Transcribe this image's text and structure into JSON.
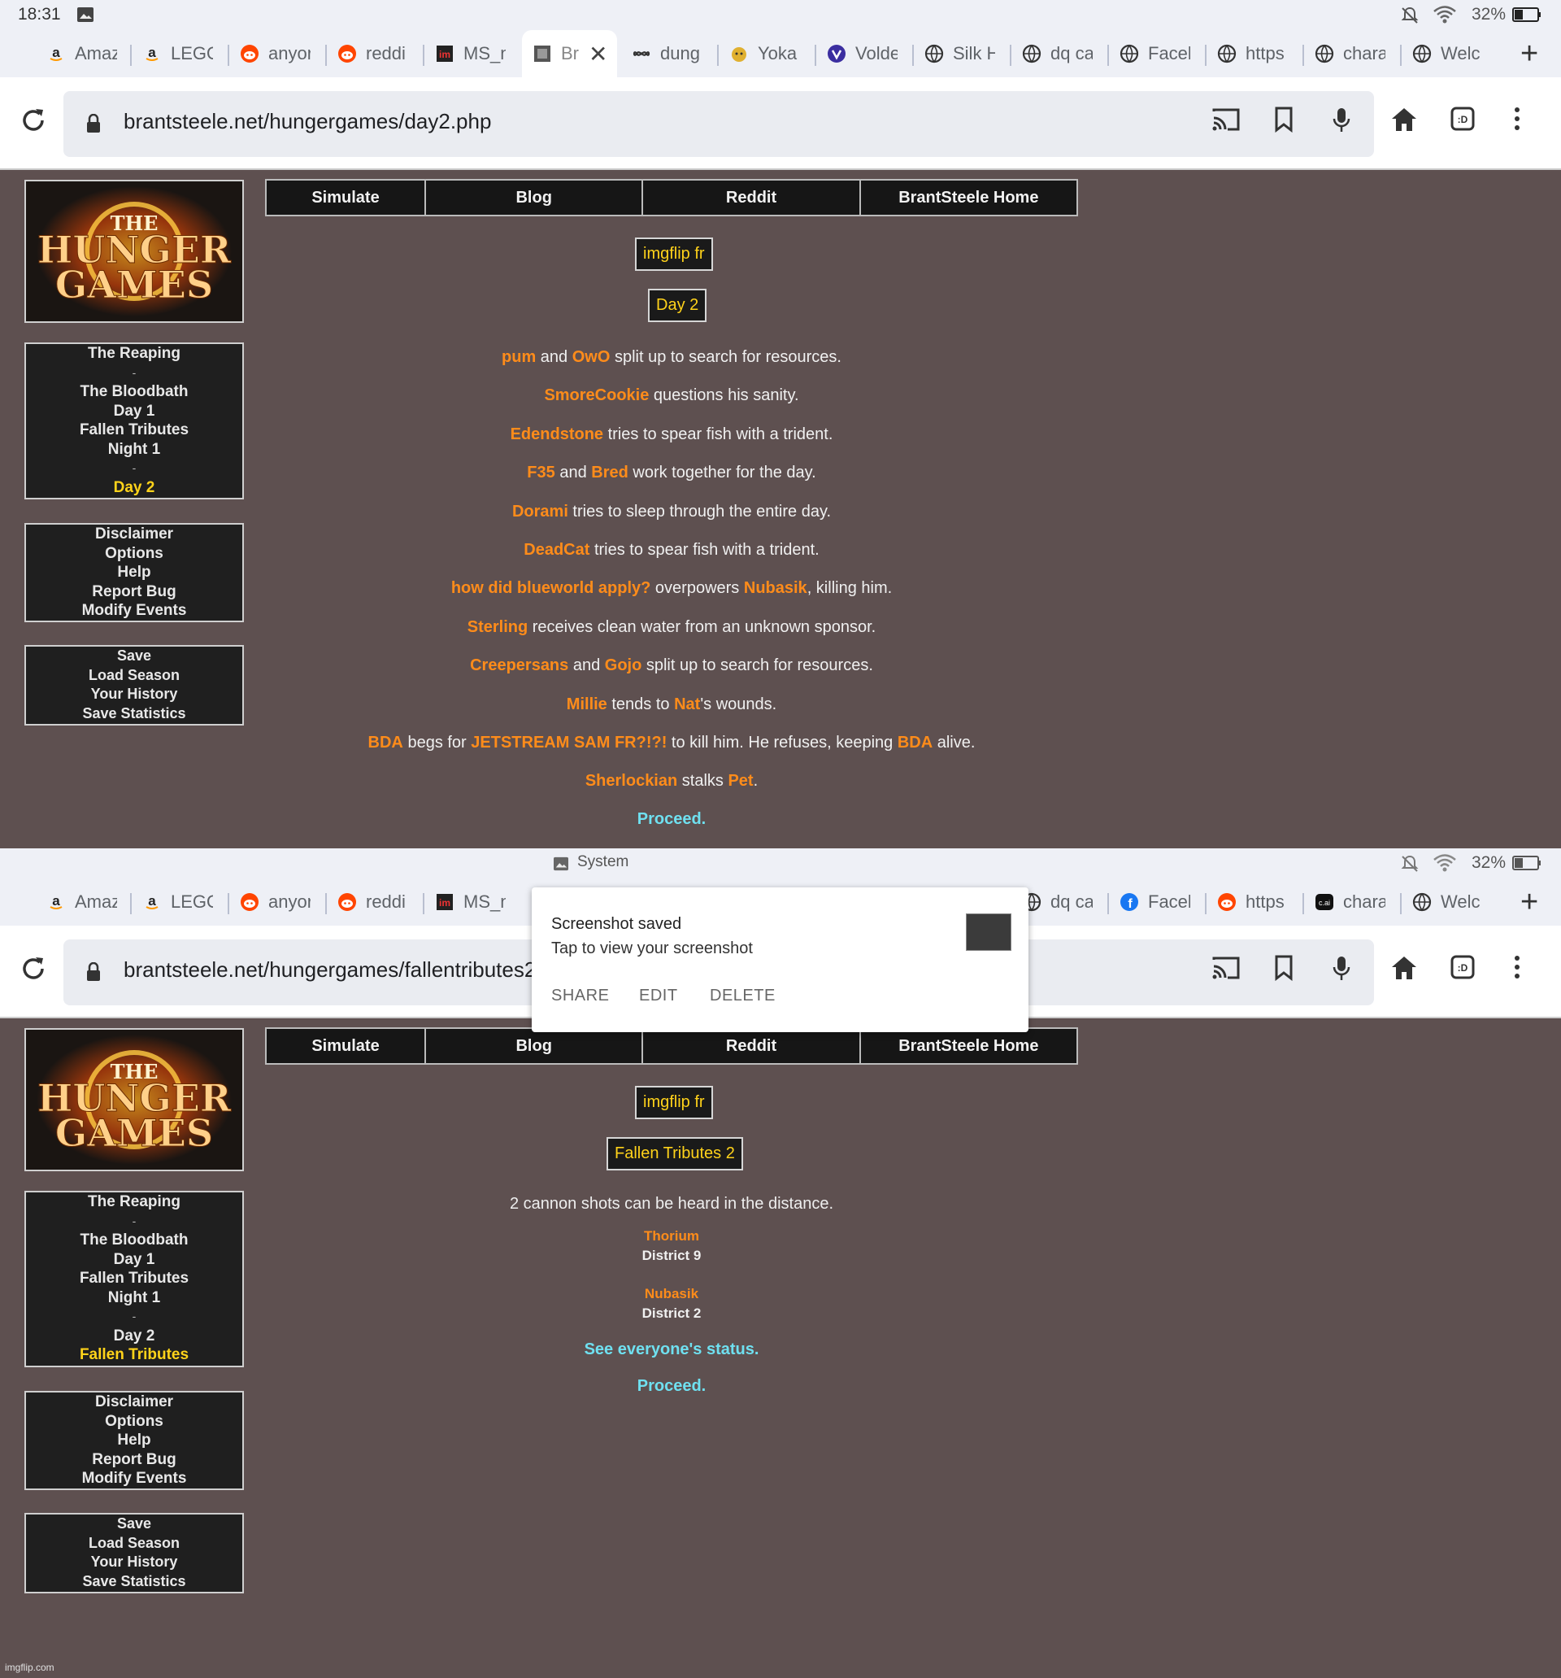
{
  "screens": [
    {
      "status": {
        "time": "18:31",
        "battery": "32%"
      },
      "tabs": [
        {
          "label": "Amaz",
          "icon": "amazon-icon"
        },
        {
          "label": "LEGO",
          "icon": "amazon-icon"
        },
        {
          "label": "anyor",
          "icon": "reddit-icon"
        },
        {
          "label": "reddi",
          "icon": "reddit-icon"
        },
        {
          "label": "MS_n",
          "icon": "imgflip-icon"
        },
        {
          "label": "Br",
          "icon": "site-icon",
          "active": true
        },
        {
          "label": "dung",
          "icon": "infinity-icon"
        },
        {
          "label": "Yoka",
          "icon": "yokai-icon"
        },
        {
          "label": "Volde",
          "icon": "shield-icon"
        },
        {
          "label": "Silk H",
          "icon": "globe-icon"
        },
        {
          "label": "dq ca",
          "icon": "globe-icon"
        },
        {
          "label": "Faceb",
          "icon": "globe-icon"
        },
        {
          "label": "https",
          "icon": "globe-icon"
        },
        {
          "label": "chara",
          "icon": "globe-icon"
        },
        {
          "label": "Welc",
          "icon": "globe-icon"
        }
      ],
      "url": "brantsteele.net/hungergames/day2.php",
      "nav": [
        "Simulate",
        "Blog",
        "Reddit",
        "BrantSteele Home"
      ],
      "sidebar": {
        "logo": {
          "line1": "THE",
          "line2": "HUNGER",
          "line3": "GAMES"
        },
        "progress": [
          "The Reaping",
          "-",
          "The Bloodbath",
          "Day 1",
          "Fallen Tributes",
          "Night 1",
          "-",
          "Day 2"
        ],
        "menu": [
          "Disclaimer",
          "Options",
          "Help",
          "Report Bug",
          "Modify Events"
        ],
        "save": [
          "Save",
          "Load Season",
          "Your History",
          "Save Statistics"
        ]
      },
      "season_name": "imgflip fr",
      "phase_title": "Day 2",
      "events": [
        [
          {
            "t": "pum"
          },
          {
            "s": " and "
          },
          {
            "t": "OwO"
          },
          {
            "s": " split up to search for resources."
          }
        ],
        [
          {
            "t": "SmoreCookie"
          },
          {
            "s": " questions his sanity."
          }
        ],
        [
          {
            "t": "Edendstone"
          },
          {
            "s": " tries to spear fish with a trident."
          }
        ],
        [
          {
            "t": "F35"
          },
          {
            "s": " and "
          },
          {
            "t": "Bred"
          },
          {
            "s": " work together for the day."
          }
        ],
        [
          {
            "t": "Dorami"
          },
          {
            "s": " tries to sleep through the entire day."
          }
        ],
        [
          {
            "t": "DeadCat"
          },
          {
            "s": " tries to spear fish with a trident."
          }
        ],
        [
          {
            "t": "how did blueworld apply?"
          },
          {
            "s": " overpowers "
          },
          {
            "t": "Nubasik"
          },
          {
            "s": ", killing him."
          }
        ],
        [
          {
            "t": "Sterling"
          },
          {
            "s": " receives clean water from an unknown sponsor."
          }
        ],
        [
          {
            "t": "Creepersans"
          },
          {
            "s": " and "
          },
          {
            "t": "Gojo"
          },
          {
            "s": " split up to search for resources."
          }
        ],
        [
          {
            "t": "Millie"
          },
          {
            "s": " tends to "
          },
          {
            "t": "Nat"
          },
          {
            "s": "'s wounds."
          }
        ],
        [
          {
            "t": "BDA"
          },
          {
            "s": " begs for "
          },
          {
            "t": "JETSTREAM SAM FR?!?!"
          },
          {
            "s": " to kill him. He refuses, keeping "
          },
          {
            "t": "BDA"
          },
          {
            "s": " alive."
          }
        ],
        [
          {
            "t": "Sherlockian"
          },
          {
            "s": " stalks "
          },
          {
            "t": "Pet"
          },
          {
            "s": "."
          }
        ]
      ],
      "proceed": "Proceed."
    },
    {
      "status": {
        "system_label": "System",
        "battery": "32%"
      },
      "tabs": [
        {
          "label": "Amaz",
          "icon": "amazon-icon"
        },
        {
          "label": "LEGO",
          "icon": "amazon-icon"
        },
        {
          "label": "anyor",
          "icon": "reddit-icon"
        },
        {
          "label": "reddi",
          "icon": "reddit-icon"
        },
        {
          "label": "MS_n",
          "icon": "imgflip-icon"
        },
        {
          "label": "dq ca",
          "icon": "globe-icon"
        },
        {
          "label": "Faceb",
          "icon": "facebook-icon"
        },
        {
          "label": "https",
          "icon": "reddit-icon"
        },
        {
          "label": "chara",
          "icon": "cai-icon"
        },
        {
          "label": "Welc",
          "icon": "globe-icon"
        }
      ],
      "url": "brantsteele.net/hungergames/fallentributes2.pl",
      "nav": [
        "Simulate",
        "Blog",
        "Reddit",
        "BrantSteele Home"
      ],
      "sidebar": {
        "logo": {
          "line1": "THE",
          "line2": "HUNGER",
          "line3": "GAMES"
        },
        "progress": [
          "The Reaping",
          "-",
          "The Bloodbath",
          "Day 1",
          "Fallen Tributes",
          "Night 1",
          "-",
          "Day 2",
          "Fallen Tributes"
        ],
        "menu": [
          "Disclaimer",
          "Options",
          "Help",
          "Report Bug",
          "Modify Events"
        ],
        "save": [
          "Save",
          "Load Season",
          "Your History",
          "Save Statistics"
        ]
      },
      "season_name": "imgflip fr",
      "phase_title": "Fallen Tributes 2",
      "cannon_text": "2 cannon shots can be heard in the distance.",
      "fallen": [
        {
          "name": "Thorium",
          "district": "District 9"
        },
        {
          "name": "Nubasik",
          "district": "District 2"
        }
      ],
      "status_link": "See everyone's status.",
      "proceed": "Proceed."
    }
  ],
  "toast": {
    "title": "Screenshot saved",
    "subtitle": "Tap to view your screenshot",
    "actions": [
      "SHARE",
      "EDIT",
      "DELETE"
    ]
  },
  "watermark": "imgflip.com",
  "colors": {
    "tribute": "#ff8c1a",
    "link": "#6fe0f0",
    "highlight": "#ffd31a",
    "page_bg": "#5e5050"
  }
}
